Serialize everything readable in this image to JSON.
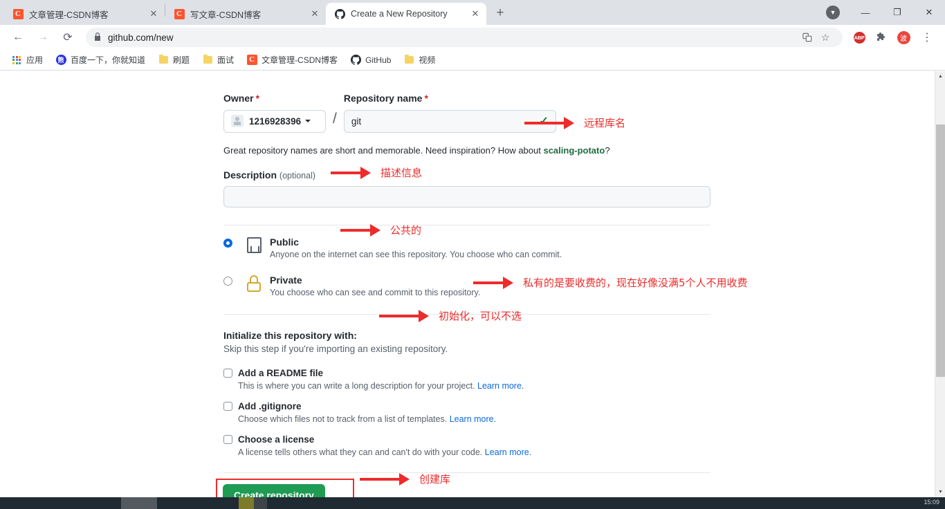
{
  "browser": {
    "tabs": [
      {
        "title": "文章管理-CSDN博客",
        "favicon": "csdn-icon",
        "active": false,
        "close_label": "✕"
      },
      {
        "title": "写文章-CSDN博客",
        "favicon": "csdn-icon",
        "active": false,
        "close_label": "✕"
      },
      {
        "title": "Create a New Repository",
        "favicon": "github-icon",
        "active": true,
        "close_label": "✕"
      }
    ],
    "new_tab_label": "+",
    "window_controls": {
      "profile": "▼",
      "minimize": "—",
      "maximize": "❐",
      "close": "✕"
    },
    "toolbar": {
      "back": "←",
      "forward": "→",
      "reload": "⟳",
      "lock": "🔒",
      "url": "github.com/new",
      "translate": "translate-icon",
      "bookmark_star": "☆",
      "ext_abp": "ABP",
      "ext_puzzle": "puzzle-icon",
      "ext_avatar": "波",
      "menu": "⋮"
    },
    "bookmarks": [
      {
        "label": "应用",
        "icon": "apps-grid-icon"
      },
      {
        "label": "百度一下，你就知道",
        "icon": "baidu-icon"
      },
      {
        "label": "刷题",
        "icon": "folder-icon"
      },
      {
        "label": "面试",
        "icon": "folder-icon"
      },
      {
        "label": "文章管理-CSDN博客",
        "icon": "csdn-icon"
      },
      {
        "label": "GitHub",
        "icon": "github-icon"
      },
      {
        "label": "视频",
        "icon": "folder-icon"
      }
    ]
  },
  "form": {
    "owner": {
      "label": "Owner",
      "required_mark": "*",
      "value": "1216928396"
    },
    "separator": "/",
    "repo_name": {
      "label": "Repository name",
      "required_mark": "*",
      "value": "git",
      "valid_mark": "✓"
    },
    "hint": {
      "text_before": "Great repository names are short and memorable. Need inspiration? How about ",
      "suggestion": "scaling-potato",
      "text_after": "?"
    },
    "description": {
      "label": "Description",
      "optional": "(optional)",
      "value": "",
      "placeholder": ""
    },
    "visibility": {
      "public": {
        "title": "Public",
        "sub": "Anyone on the internet can see this repository. You choose who can commit.",
        "selected": true,
        "icon": "repo-book-icon"
      },
      "private": {
        "title": "Private",
        "sub": "You choose who can see and commit to this repository.",
        "selected": false,
        "icon": "lock-icon"
      }
    },
    "initialize": {
      "title": "Initialize this repository with:",
      "sub": "Skip this step if you're importing an existing repository.",
      "options": [
        {
          "title": "Add a README file",
          "sub_before": "This is where you can write a long description for your project. ",
          "link": "Learn more.",
          "checked": false
        },
        {
          "title": "Add .gitignore",
          "sub_before": "Choose which files not to track from a list of templates. ",
          "link": "Learn more.",
          "checked": false
        },
        {
          "title": "Choose a license",
          "sub_before": "A license tells others what they can and can't do with your code. ",
          "link": "Learn more.",
          "checked": false
        }
      ]
    },
    "submit_label": "Create repository"
  },
  "annotations": [
    {
      "text": "远程库名"
    },
    {
      "text": "描述信息"
    },
    {
      "text": "公共的"
    },
    {
      "text": "私有的是要收费的，现在好像没满5个人不用收费"
    },
    {
      "text": "初始化，可以不选"
    },
    {
      "text": "创建库"
    }
  ],
  "scrollbar": {
    "up_arrow": "▲",
    "down_arrow": "▼"
  },
  "taskbar": {
    "time": "15:09"
  },
  "colors": {
    "accent_green": "#1f9b53",
    "annotation_red": "#ee2b2b",
    "link_blue": "#0969da",
    "radio_blue": "#0969da",
    "lock_gold": "#d4a72c",
    "required_red": "#cf222e"
  }
}
